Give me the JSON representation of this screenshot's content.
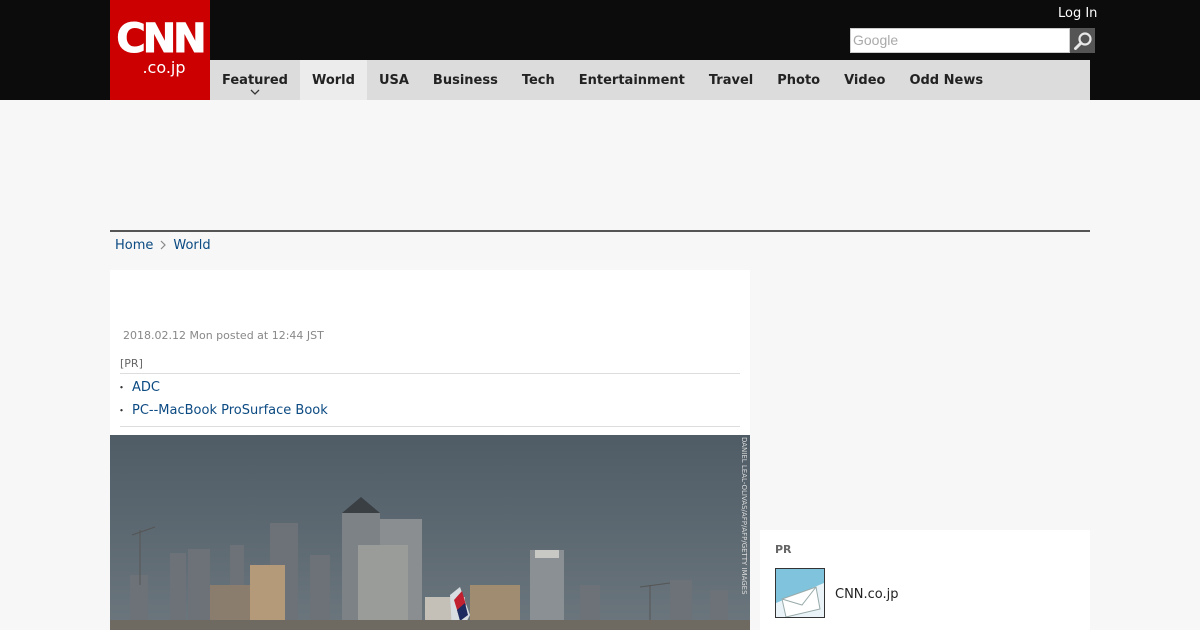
{
  "header": {
    "logo_main": "CNN",
    "logo_sub": ".co.jp",
    "login_label": "Log In",
    "search_placeholder": "Google"
  },
  "nav": {
    "items": [
      {
        "label": "Featured"
      },
      {
        "label": "World"
      },
      {
        "label": "USA"
      },
      {
        "label": "Business"
      },
      {
        "label": "Tech"
      },
      {
        "label": "Entertainment"
      },
      {
        "label": "Travel"
      },
      {
        "label": "Photo"
      },
      {
        "label": "Video"
      },
      {
        "label": "Odd News"
      }
    ]
  },
  "breadcrumb": {
    "home": "Home",
    "current": "World"
  },
  "article": {
    "posted": "2018.02.12 Mon posted at 12:44 JST",
    "pr_label": "[PR]",
    "pr_links": [
      "ADC",
      "PC--MacBook ProSurface Book"
    ],
    "photo_credit": "DANIEL LEAL-OLIVAS/AFP/AFP/GETTY IMAGES"
  },
  "sidebar": {
    "pr_label": "PR",
    "pr_item_label": "CNN.co.jp"
  },
  "colors": {
    "brand_red": "#cc0000",
    "header_black": "#0c0c0c",
    "nav_gray": "#dcdcdc",
    "link_blue": "#0b4a82"
  }
}
